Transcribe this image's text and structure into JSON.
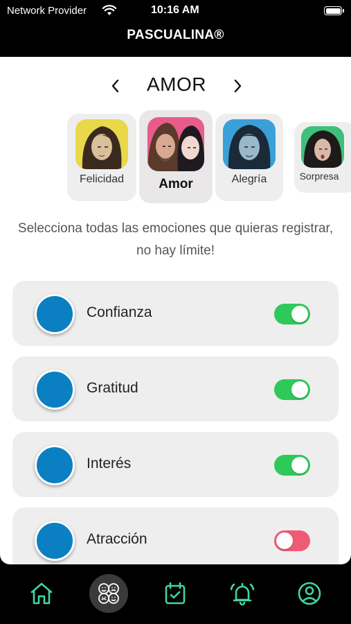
{
  "status_bar": {
    "provider": "Network Provider",
    "time": "10:16 AM"
  },
  "app_title": "PASCUALINA®",
  "category_nav": {
    "title": "AMOR"
  },
  "emotion_categories": [
    {
      "label": "Felicidad",
      "selected": false,
      "color": "#e8d84a"
    },
    {
      "label": "Amor",
      "selected": true,
      "color": "#e85c8a"
    },
    {
      "label": "Alegría",
      "selected": false,
      "color": "#3aa0d8"
    },
    {
      "label": "Sorpresa",
      "selected": false,
      "color": "#3ec07a"
    }
  ],
  "helper_text": {
    "line1": "Selecciona todas las emociones que quieras registrar,",
    "line2": "no hay límite!"
  },
  "emotions": [
    {
      "label": "Confianza",
      "enabled": true
    },
    {
      "label": "Gratitud",
      "enabled": true
    },
    {
      "label": "Interés",
      "enabled": true
    },
    {
      "label": "Atracción",
      "enabled": false
    }
  ],
  "colors": {
    "toggle_on": "#2fc95a",
    "toggle_off": "#ef5b74",
    "dot": "#0a80c2",
    "tab_icon": "#3fd6a4"
  },
  "tabs": [
    {
      "name": "home",
      "active": false
    },
    {
      "name": "emotions",
      "active": true
    },
    {
      "name": "calendar",
      "active": false
    },
    {
      "name": "alarms",
      "active": false
    },
    {
      "name": "profile",
      "active": false
    }
  ]
}
